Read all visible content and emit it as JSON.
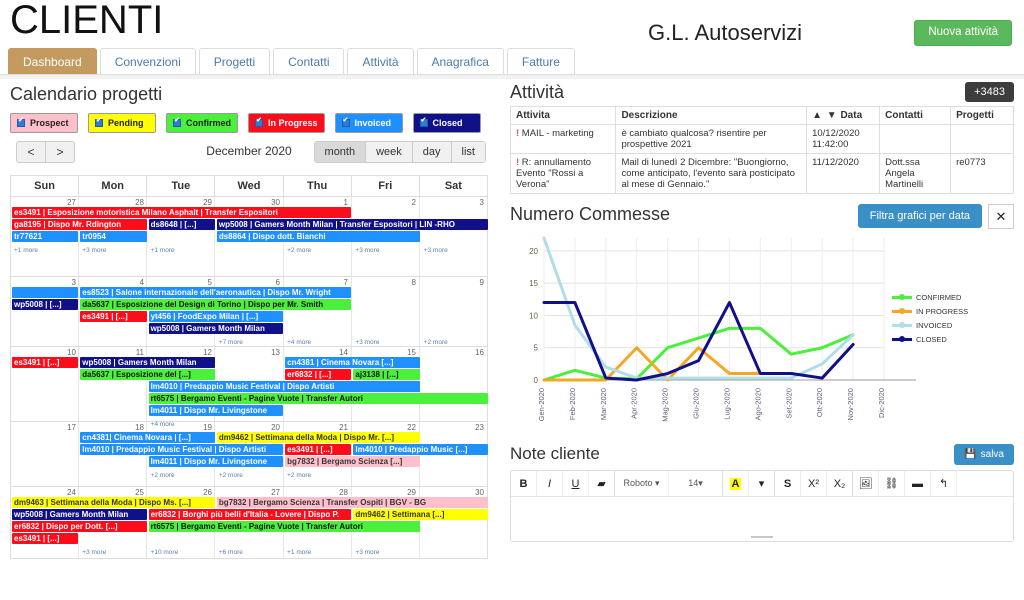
{
  "header": {
    "title": "CLIENTI",
    "client_name": "G.L. Autoservizi",
    "new_activity_label": "Nuova attività"
  },
  "tabs": [
    {
      "label": "Dashboard",
      "active": true
    },
    {
      "label": "Convenzioni",
      "active": false
    },
    {
      "label": "Progetti",
      "active": false
    },
    {
      "label": "Contatti",
      "active": false
    },
    {
      "label": "Attività",
      "active": false
    },
    {
      "label": "Anagrafica",
      "active": false
    },
    {
      "label": "Fatture",
      "active": false
    }
  ],
  "calendar": {
    "title": "Calendario progetti",
    "legend": [
      {
        "label": "Prospect",
        "color": "#ffc0cb"
      },
      {
        "label": "Pending",
        "color": "#ffff00"
      },
      {
        "label": "Confirmed",
        "color": "#4bf03b"
      },
      {
        "label": "In Progress",
        "color": "#fc0d1b"
      },
      {
        "label": "Invoiced",
        "color": "#1e90ff"
      },
      {
        "label": "Closed",
        "color": "#101089"
      }
    ],
    "prev_label": "<",
    "next_label": ">",
    "month_label": "December 2020",
    "views": [
      {
        "label": "month",
        "selected": true
      },
      {
        "label": "week",
        "selected": false
      },
      {
        "label": "day",
        "selected": false
      },
      {
        "label": "list",
        "selected": false
      }
    ],
    "weekdays": [
      "Sun",
      "Mon",
      "Tue",
      "Wed",
      "Thu",
      "Fri",
      "Sat"
    ],
    "weeks": [
      {
        "daynums": [
          "27",
          "28",
          "29",
          "30",
          "1",
          "2",
          "3"
        ],
        "events": [
          {
            "text": "es3491 | Esposizione motoristica Milano Asphalt | Transfer Espositori",
            "type": "inprog",
            "col": 0,
            "span": 5,
            "row": 0
          },
          {
            "text": "ga8195 | Dispo Mr. Rdington",
            "type": "inprog",
            "col": 0,
            "span": 2,
            "row": 1
          },
          {
            "text": "ds8648 | [...]",
            "type": "closed",
            "col": 2,
            "span": 1,
            "row": 1
          },
          {
            "text": "wp5008 | Gamers Month Milan | Transfer Espositori | LIN -RHO",
            "type": "closed",
            "col": 3,
            "span": 4,
            "row": 1
          },
          {
            "text": "tr77621",
            "type": "invoiced",
            "col": 0,
            "span": 1,
            "row": 2
          },
          {
            "text": "tr0954",
            "type": "invoiced",
            "col": 1,
            "span": 1,
            "row": 2
          },
          {
            "text": "ds8864 | Dispo dott. Bianchi",
            "type": "invoiced",
            "col": 3,
            "span": 3,
            "row": 2
          }
        ],
        "more": [
          {
            "text": "+1 more",
            "col": 0
          },
          {
            "text": "+3 more",
            "col": 1
          },
          {
            "text": "+1 more",
            "col": 2
          },
          {
            "text": "+2 more",
            "col": 4
          },
          {
            "text": "+3 more",
            "col": 5
          },
          {
            "text": "+3 more",
            "col": 6
          }
        ]
      },
      {
        "daynums": [
          "3",
          "4",
          "5",
          "6",
          "7",
          "8",
          "9"
        ],
        "events": [
          {
            "text": "",
            "type": "invoiced",
            "col": 0,
            "span": 1,
            "row": 0
          },
          {
            "text": "es8523 | Salone internazionale dell'aeronautica | Dispo Mr. Wright",
            "type": "invoiced",
            "col": 1,
            "span": 4,
            "row": 0
          },
          {
            "text": "wp5008 | [...]",
            "type": "closed",
            "col": 0,
            "span": 1,
            "row": 1
          },
          {
            "text": "da5637 | Esposizione del Design di Torino | Dispo per Mr. Smith",
            "type": "confirmed",
            "col": 1,
            "span": 4,
            "row": 1
          },
          {
            "text": "es3491 | [...]",
            "type": "inprog",
            "col": 1,
            "span": 1,
            "row": 2
          },
          {
            "text": "yt456 | FoodExpo Milan | [...]",
            "type": "invoiced",
            "col": 2,
            "span": 2,
            "row": 2
          },
          {
            "text": "wp5008 | Gamers Month Milan",
            "type": "closed",
            "col": 2,
            "span": 2,
            "row": 3
          }
        ],
        "more": [
          {
            "text": "+7 more",
            "col": 3
          },
          {
            "text": "+4 more",
            "col": 4
          },
          {
            "text": "+3 more",
            "col": 5
          },
          {
            "text": "+2 more",
            "col": 6
          }
        ]
      },
      {
        "daynums": [
          "10",
          "11",
          "12",
          "13",
          "14",
          "15",
          "16"
        ],
        "events": [
          {
            "text": "es3491 | [...]",
            "type": "inprog",
            "col": 0,
            "span": 1,
            "row": 0
          },
          {
            "text": "wp5008 | Gamers Month Milan",
            "type": "closed",
            "col": 1,
            "span": 2,
            "row": 0
          },
          {
            "text": "cn4381 | Cinema Novara [...]",
            "type": "invoiced",
            "col": 4,
            "span": 2,
            "row": 0
          },
          {
            "text": "da5637 | Esposizione del [...]",
            "type": "confirmed",
            "col": 1,
            "span": 2,
            "row": 1
          },
          {
            "text": "er6832 | [...]",
            "type": "inprog",
            "col": 4,
            "span": 1,
            "row": 1
          },
          {
            "text": "aj3138 | [...]",
            "type": "confirmed",
            "col": 5,
            "span": 1,
            "row": 1
          },
          {
            "text": "lm4010 | Predappio Music Festival | Dispo Artisti",
            "type": "invoiced",
            "col": 2,
            "span": 4,
            "row": 2
          },
          {
            "text": "rt6575 | Bergamo Eventi - Pagine Vuote | Transfer Autori",
            "type": "confirmed",
            "col": 2,
            "span": 5,
            "row": 3
          },
          {
            "text": "lm4011 | Dispo Mr. Livingstone",
            "type": "invoiced",
            "col": 2,
            "span": 2,
            "row": 4
          }
        ],
        "more": [
          {
            "text": "+4 more",
            "col": 2
          }
        ]
      },
      {
        "daynums": [
          "17",
          "18",
          "19",
          "20",
          "21",
          "22",
          "23"
        ],
        "events": [
          {
            "text": "cn4381| Cinema Novara | [...]",
            "type": "invoiced",
            "col": 1,
            "span": 2,
            "row": 0
          },
          {
            "text": "dm9462 | Settimana della Moda | Dispo Mr. [...]",
            "type": "pending",
            "col": 3,
            "span": 3,
            "row": 0
          },
          {
            "text": "lm4010 | Predappio Music Festival | Dispo Artisti",
            "type": "invoiced",
            "col": 1,
            "span": 3,
            "row": 1
          },
          {
            "text": "es3491 | [...]",
            "type": "inprog",
            "col": 4,
            "span": 1,
            "row": 1
          },
          {
            "text": "lm4010 | Predappio Music [...]",
            "type": "invoiced",
            "col": 5,
            "span": 2,
            "row": 1
          },
          {
            "text": "lm4011 | Dispo Mr. Livingstone",
            "type": "invoiced",
            "col": 2,
            "span": 2,
            "row": 2
          },
          {
            "text": "bg7832 | Bergamo Scienza [...]",
            "type": "prospect",
            "col": 4,
            "span": 2,
            "row": 2
          }
        ],
        "more": [
          {
            "text": "+2 more",
            "col": 2
          },
          {
            "text": "+2 more",
            "col": 3
          },
          {
            "text": "+2 more",
            "col": 4
          }
        ]
      },
      {
        "daynums": [
          "24",
          "25",
          "26",
          "27",
          "28",
          "29",
          "30"
        ],
        "events": [
          {
            "text": "dm9463 | Settimana della Moda | Dispo Ms. [...]",
            "type": "pending",
            "col": 0,
            "span": 3,
            "row": 0
          },
          {
            "text": "bg7832 | Bergamo Scienza | Transfer Ospiti | BGV - BG",
            "type": "prospect",
            "col": 3,
            "span": 4,
            "row": 0
          },
          {
            "text": "wp5008 | Gamers Month Milan",
            "type": "closed",
            "col": 0,
            "span": 2,
            "row": 1
          },
          {
            "text": "er6832 | Borghi più belli d'Italia - Lovere | Dispo P.",
            "type": "inprog",
            "col": 2,
            "span": 3,
            "row": 1
          },
          {
            "text": "dm9462 | Settimana  [...]",
            "type": "pending",
            "col": 5,
            "span": 2,
            "row": 1
          },
          {
            "text": "er6832 | Dispo per Dott. [...]",
            "type": "inprog",
            "col": 0,
            "span": 2,
            "row": 2
          },
          {
            "text": "rt6575 | Bergamo Eventi - Pagine Vuote | Transfer Autori",
            "type": "confirmed",
            "col": 2,
            "span": 4,
            "row": 2
          },
          {
            "text": "es3491 | [...]",
            "type": "inprog",
            "col": 0,
            "span": 1,
            "row": 3
          }
        ],
        "more": [
          {
            "text": "+3 more",
            "col": 1
          },
          {
            "text": "+10 more",
            "col": 2
          },
          {
            "text": "+6 more",
            "col": 3
          },
          {
            "text": "+1 more",
            "col": 4
          },
          {
            "text": "+3 more",
            "col": 5
          }
        ]
      }
    ]
  },
  "activities": {
    "title": "Attività",
    "count_badge": "+3483",
    "columns": [
      "Attivita",
      "Descrizione",
      "Data",
      "Contatti",
      "Progetti"
    ],
    "sort_icons": "▲ ▼",
    "rows": [
      {
        "attivita": "MAIL - marketing",
        "alert": "!",
        "descrizione": "è cambiato qualcosa? risentire per prospettive 2021",
        "data": "10/12/2020 11:42:00",
        "data_highlight": false,
        "contatti": "",
        "progetti": ""
      },
      {
        "attivita": "R: annullamento Evento \"Rossi a Verona\"",
        "alert": "!",
        "descrizione": "Mail di lunedì 2 Dicembre: \"Buongiorno, come anticipato, l'evento sarà posticipato al mese di Gennaio.\"",
        "data": "11/12/2020",
        "data_highlight": true,
        "contatti": "Dott.ssa Angela Martinelli",
        "progetti": "re0773"
      }
    ]
  },
  "chart_panel": {
    "title": "Numero Commesse",
    "filter_label": "Filtra grafici per data",
    "close_label": "✕"
  },
  "chart_data": {
    "type": "line",
    "title": "Numero Commesse",
    "xlabel": "",
    "ylabel": "",
    "ylim": [
      0,
      22
    ],
    "yticks": [
      0,
      5,
      10,
      15,
      20
    ],
    "grid": true,
    "legend_position": "right",
    "categories": [
      "Gen-2020",
      "Feb-2020",
      "Mar-2020",
      "Apr-2020",
      "Mag-2020",
      "Giu-2020",
      "Lug-2020",
      "Ago-2020",
      "Set-2020",
      "Ott-2020",
      "Nov-2020",
      "Dic-2020"
    ],
    "series": [
      {
        "name": "CONFIRMED",
        "color": "#4bf03b",
        "values": [
          0,
          1.5,
          0.3,
          0.2,
          5,
          6.5,
          8,
          8,
          4,
          5,
          7,
          null
        ]
      },
      {
        "name": "IN PROGRESS",
        "color": "#f5a623",
        "values": [
          0,
          0,
          0,
          5,
          0,
          5,
          1,
          1,
          1,
          null,
          null,
          null
        ]
      },
      {
        "name": "INVOICED",
        "color": "#b0dde8",
        "values": [
          22,
          8.5,
          2,
          0.3,
          0.3,
          0.3,
          0.3,
          0.3,
          0.3,
          2.5,
          7,
          null
        ]
      },
      {
        "name": "CLOSED",
        "color": "#101089",
        "values": [
          12,
          12,
          0.3,
          0,
          1,
          3,
          12,
          1,
          1,
          0.3,
          5.5,
          null
        ]
      }
    ]
  },
  "notes": {
    "title": "Note cliente",
    "save_label": "salva",
    "toolbar": [
      {
        "name": "bold",
        "label": "B"
      },
      {
        "name": "italic",
        "label": "I"
      },
      {
        "name": "underline",
        "label": "U"
      },
      {
        "name": "clear-format",
        "label": "▰"
      },
      {
        "name": "font-family",
        "label": "Roboto ▾"
      },
      {
        "name": "font-size",
        "label": "14▾"
      },
      {
        "name": "text-color",
        "label": "A"
      },
      {
        "name": "color-dropdown",
        "label": "▾"
      },
      {
        "name": "strikethrough",
        "label": "S"
      },
      {
        "name": "superscript",
        "label": "X²"
      },
      {
        "name": "subscript",
        "label": "X₂"
      },
      {
        "name": "insert-image",
        "label": "🖼"
      },
      {
        "name": "insert-link",
        "label": "⛓"
      },
      {
        "name": "insert-video",
        "label": "▬"
      },
      {
        "name": "undo",
        "label": "↰"
      }
    ],
    "body_text": ""
  }
}
